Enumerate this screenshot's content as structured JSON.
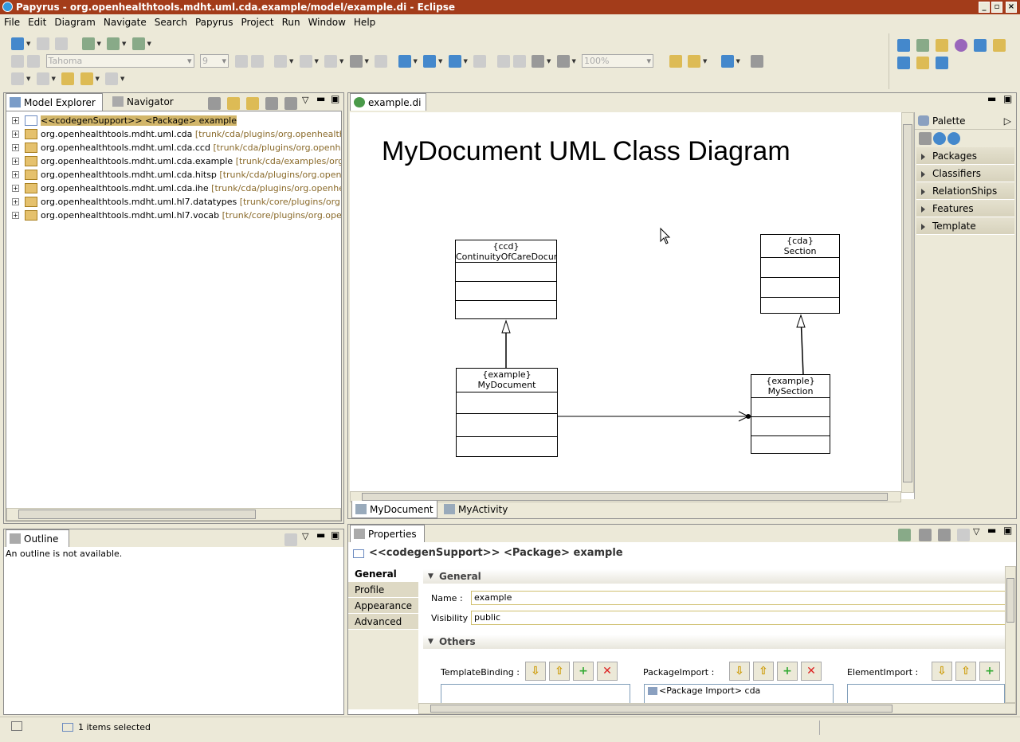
{
  "window": {
    "title": "Papyrus - org.openhealthtools.mdht.uml.cda.example/model/example.di - Eclipse"
  },
  "menu": [
    "File",
    "Edit",
    "Diagram",
    "Navigate",
    "Search",
    "Papyrus",
    "Project",
    "Run",
    "Window",
    "Help"
  ],
  "toolbar": {
    "font_name": "Tahoma",
    "font_size": "9",
    "zoom": "100%"
  },
  "model_explorer": {
    "tabs": [
      {
        "label": "Model Explorer"
      },
      {
        "label": "Navigator"
      }
    ],
    "items": [
      {
        "label": "<<codegenSupport>> <Package> example",
        "location": ""
      },
      {
        "label": "org.openhealthtools.mdht.uml.cda",
        "location": "[trunk/cda/plugins/org.openhealthtools.mdht.u"
      },
      {
        "label": "org.openhealthtools.mdht.uml.cda.ccd",
        "location": "[trunk/cda/plugins/org.openhealthtools.m"
      },
      {
        "label": "org.openhealthtools.mdht.uml.cda.example",
        "location": "[trunk/cda/examples/org.openhealth"
      },
      {
        "label": "org.openhealthtools.mdht.uml.cda.hitsp",
        "location": "[trunk/cda/plugins/org.openhealthtools.r"
      },
      {
        "label": "org.openhealthtools.mdht.uml.cda.ihe",
        "location": "[trunk/cda/plugins/org.openhealthtools.mc"
      },
      {
        "label": "org.openhealthtools.mdht.uml.hl7.datatypes",
        "location": "[trunk/core/plugins/org.openhealthto"
      },
      {
        "label": "org.openhealthtools.mdht.uml.hl7.vocab",
        "location": "[trunk/core/plugins/org.openhealthtools"
      }
    ]
  },
  "outline": {
    "tab": "Outline",
    "message": "An outline is not available."
  },
  "editor": {
    "tab": "example.di",
    "diagram_title": "MyDocument UML Class Diagram",
    "classes": [
      {
        "stereotype": "{ccd}",
        "name": "ContinuityOfCareDocumer"
      },
      {
        "stereotype": "{cda}",
        "name": "Section"
      },
      {
        "stereotype": "{example}",
        "name": "MyDocument"
      },
      {
        "stereotype": "{example}",
        "name": "MySection"
      }
    ],
    "diagram_tabs": [
      "MyDocument",
      "MyActivity"
    ]
  },
  "palette": {
    "title": "Palette",
    "drawers": [
      "Packages",
      "Classifiers",
      "RelationShips",
      "Features",
      "Template"
    ]
  },
  "properties": {
    "tab": "Properties",
    "header": "<<codegenSupport>> <Package> example",
    "side_tabs": [
      "General",
      "Profile",
      "Appearance",
      "Advanced"
    ],
    "section_general": "General",
    "name_label": "Name :",
    "name_value": "example",
    "visibility_label": "Visibility :",
    "visibility_value": "public",
    "section_others": "Others",
    "template_binding_label": "TemplateBinding :",
    "package_import_label": "PackageImport :",
    "package_import_item": "<Package Import> cda",
    "element_import_label": "ElementImport :"
  },
  "status": {
    "text": "1 items selected"
  },
  "colors": {
    "titlebar": "#a33c1a",
    "selection": "#d2b66a",
    "chrome": "#ece9d8"
  }
}
